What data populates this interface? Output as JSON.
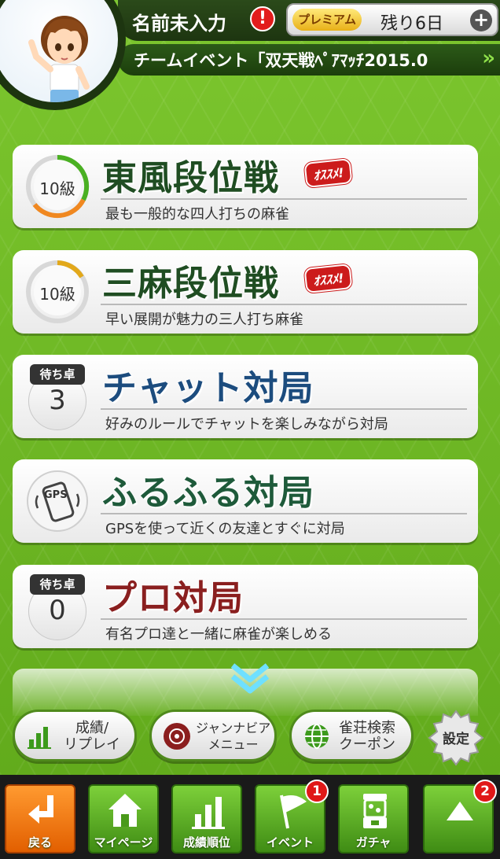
{
  "header": {
    "player_name": "名前未入力",
    "premium_label": "プレミアム",
    "premium_remaining": "残り6日",
    "event_text": "チームイベント「双天戦ﾍﾟｱﾏｯﾁ2015.0"
  },
  "menu": [
    {
      "title": "東風段位戦",
      "subtitle": "最も一般的な四人打ちの麻雀",
      "rank": "10級",
      "tag": "ｵｽｽﾒ!",
      "color": "#1f4d22"
    },
    {
      "title": "三麻段位戦",
      "subtitle": "早い展開が魅力の三人打ち麻雀",
      "rank": "10級",
      "tag": "ｵｽｽﾒ!",
      "color": "#1f4d22"
    },
    {
      "title": "チャット対局",
      "subtitle": "好みのルールでチャットを楽しみながら対局",
      "wait_label": "待ち卓",
      "wait_count": "3",
      "color": "#1c4c7e"
    },
    {
      "title": "ふるふる対局",
      "subtitle": "GPSを使って近くの友達とすぐに対局",
      "icon_text": "GPS",
      "color": "#1e5a3a"
    },
    {
      "title": "プロ対局",
      "subtitle": "有名プロ達と一緒に麻雀が楽しめる",
      "wait_label": "待ち卓",
      "wait_count": "0",
      "color": "#8a1f1f"
    }
  ],
  "shortcuts": {
    "stats_replay": "成績/\nリプレイ",
    "janavi_menu": "ジャンナビア\nメニュー",
    "parlor_search": "雀荘検索\nクーポン",
    "settings": "設定"
  },
  "tabs": [
    {
      "label": "戻る"
    },
    {
      "label": "マイページ"
    },
    {
      "label": "成績順位"
    },
    {
      "label": "イベント",
      "badge": "1"
    },
    {
      "label": "ガチャ"
    },
    {
      "label": "",
      "badge": "2"
    }
  ],
  "colors": {
    "background": "#6cb424",
    "accent_red": "#e21c1c",
    "tab_green": "#5aa81e",
    "back_orange": "#f07a10"
  }
}
